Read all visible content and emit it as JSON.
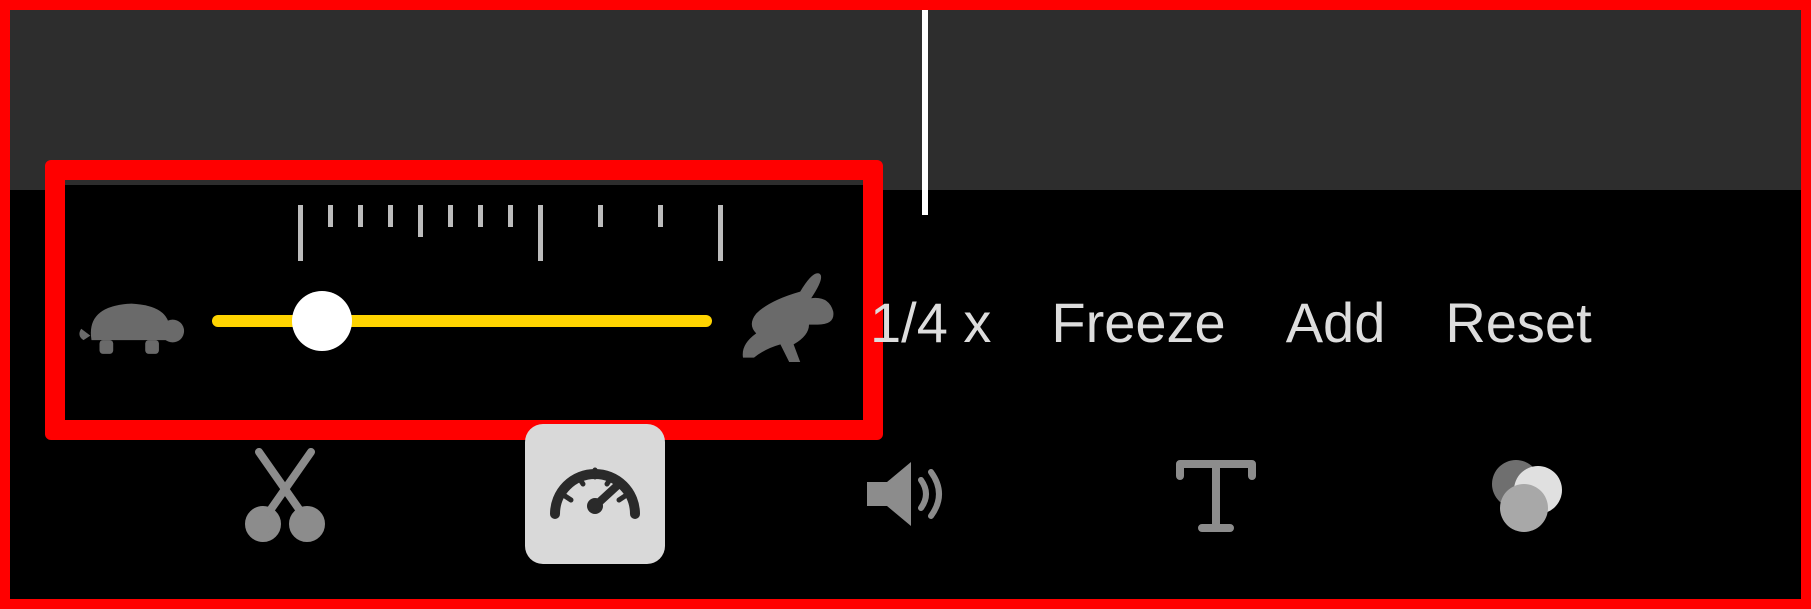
{
  "speed": {
    "min_icon": "turtle-icon",
    "max_icon": "rabbit-icon",
    "value_percent": 22,
    "options": {
      "quarter": "1/4 x",
      "freeze": "Freeze",
      "add": "Add",
      "reset": "Reset"
    }
  },
  "toolbar": {
    "cut": "scissors-icon",
    "speed": "speedometer-icon",
    "volume": "speaker-icon",
    "text": "text-icon",
    "filter": "color-filter-icon",
    "selected": "speed"
  }
}
